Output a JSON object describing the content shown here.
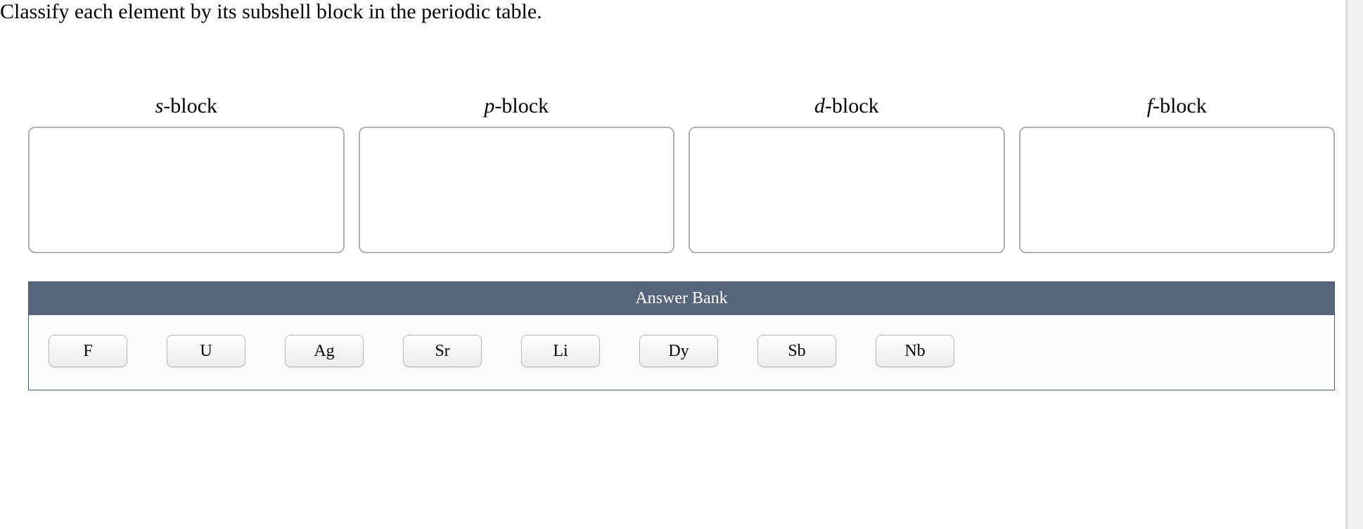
{
  "question": "Classify each element by its subshell block in the periodic table.",
  "categories": [
    {
      "prefix": "s",
      "suffix": "-block"
    },
    {
      "prefix": "p",
      "suffix": "-block"
    },
    {
      "prefix": "d",
      "suffix": "-block"
    },
    {
      "prefix": "f",
      "suffix": "-block"
    }
  ],
  "answer_bank": {
    "title": "Answer Bank",
    "items": [
      "F",
      "U",
      "Ag",
      "Sr",
      "Li",
      "Dy",
      "Sb",
      "Nb"
    ]
  }
}
